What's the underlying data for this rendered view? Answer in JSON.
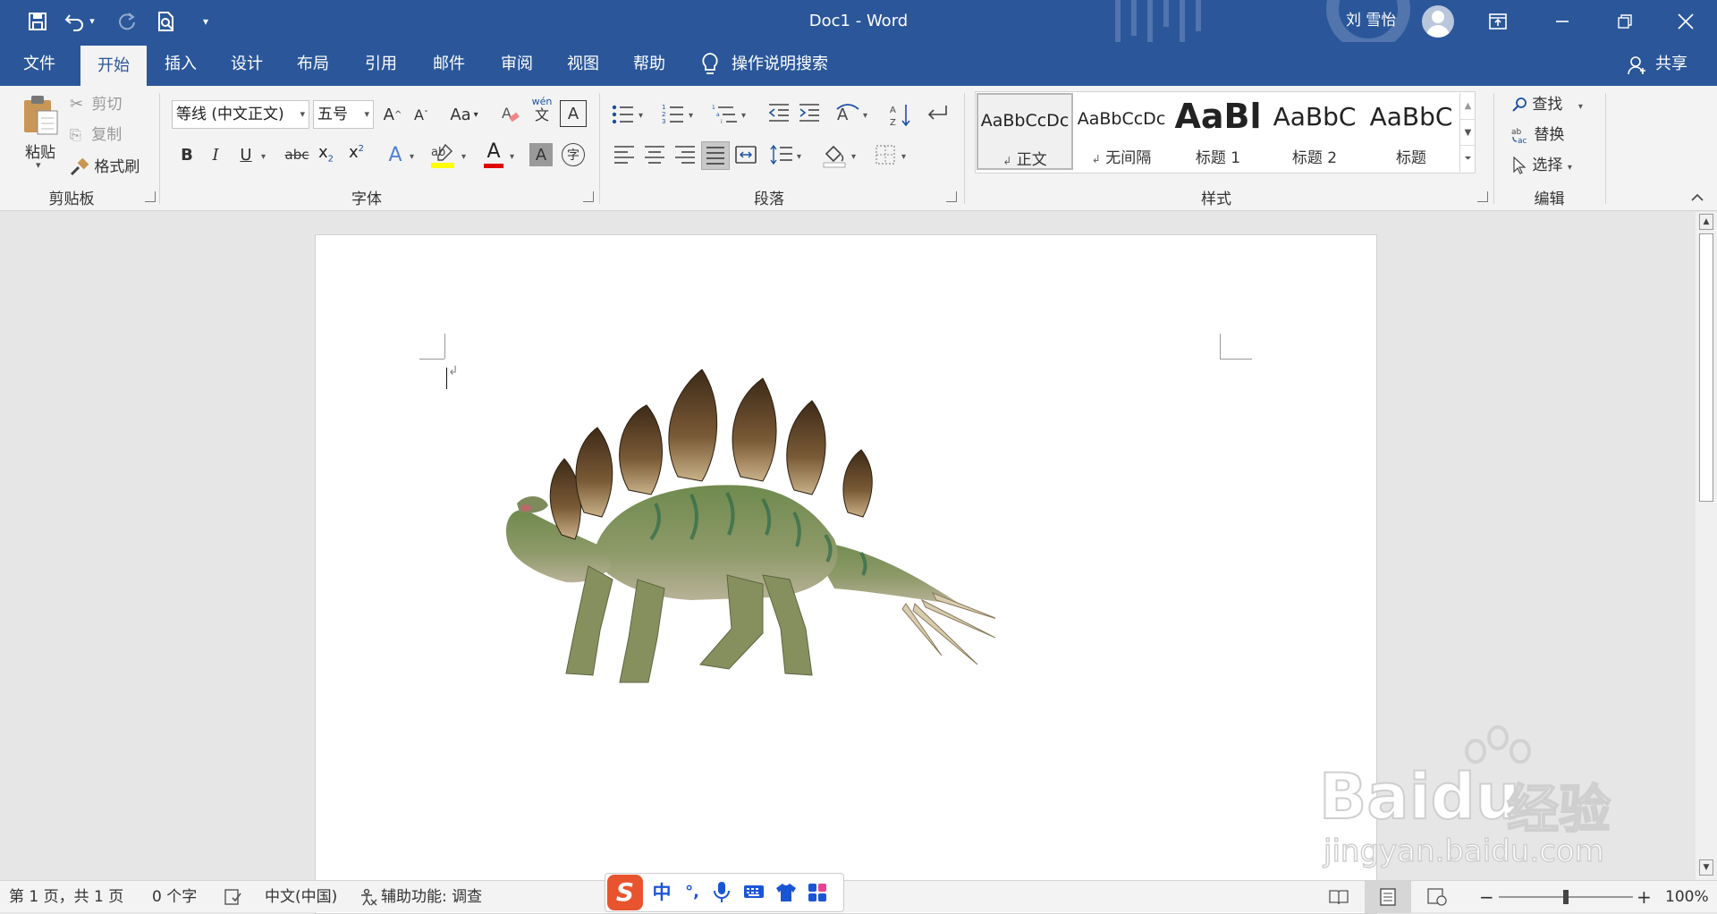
{
  "title_bar": {
    "doc_title": "Doc1  -  Word",
    "user_name": "刘 雪怡",
    "icons": [
      "save-icon",
      "undo-icon",
      "redo-icon",
      "print-preview-icon",
      "customize-qat-icon",
      "ribbon-display-icon",
      "minimize-icon",
      "restore-icon",
      "close-icon"
    ]
  },
  "tabs": [
    "文件",
    "开始",
    "插入",
    "设计",
    "布局",
    "引用",
    "邮件",
    "审阅",
    "视图",
    "帮助"
  ],
  "tell_me": "操作说明搜索",
  "share": "共享",
  "clipboard": {
    "paste": "粘贴",
    "cut": "剪切",
    "copy": "复制",
    "format_painter": "格式刷",
    "label": "剪贴板"
  },
  "font": {
    "name": "等线 (中文正文)",
    "size": "五号",
    "change_case": "Aa",
    "phonetic": "wén",
    "phonetic_base": "文",
    "bold": "B",
    "italic": "I",
    "underline": "U",
    "strike": "abc",
    "sub": "x",
    "sup": "x",
    "label": "字体"
  },
  "paragraph": {
    "label": "段落"
  },
  "styles": {
    "items": [
      {
        "preview": "AaBbCcDc",
        "name": "正文"
      },
      {
        "preview": "AaBbCcDc",
        "name": "无间隔"
      },
      {
        "preview": "AaBl",
        "name": "标题 1"
      },
      {
        "preview": "AaBbC",
        "name": "标题 2"
      },
      {
        "preview": "AaBbC",
        "name": "标题"
      }
    ],
    "label": "样式"
  },
  "editing": {
    "find": "查找",
    "replace": "替换",
    "select": "选择",
    "label": "编辑"
  },
  "status": {
    "page": "第 1 页，共 1 页",
    "words": "0 个字",
    "language": "中文(中国)",
    "accessibility": "辅助功能: 调查",
    "zoom": "100%",
    "zoom_level": 1.0
  },
  "ime": {
    "items": [
      "中",
      "°,"
    ]
  },
  "watermark": {
    "brand": "Bai",
    "brand2": "du",
    "cn": "经验",
    "url": "jingyan.baidu.com"
  },
  "colors": {
    "brand": "#2b579a",
    "highlight": "#ffff00",
    "font_color": "#e00000"
  }
}
